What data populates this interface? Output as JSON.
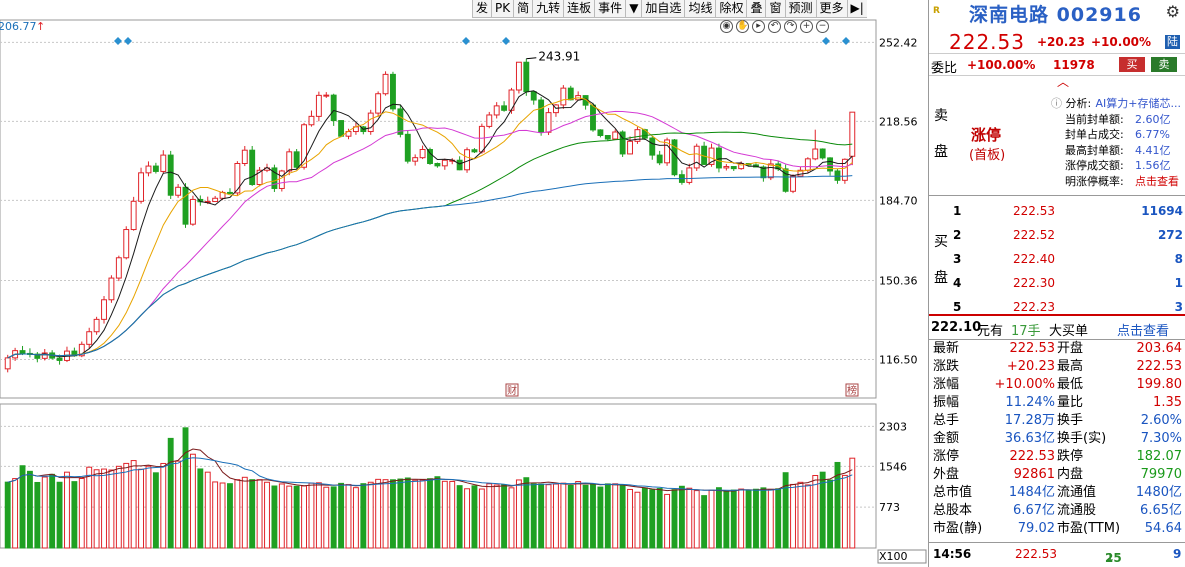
{
  "toolbar": {
    "items": [
      "发",
      "PK",
      "简",
      "九转",
      "连板",
      "事件",
      "▼",
      "加自选",
      "均线",
      "除权",
      "叠",
      "窗",
      "预测",
      "更多",
      "▶|"
    ],
    "left_value": "206.77"
  },
  "chart_top_icons": [
    "eye-icon",
    "hand-icon",
    "play-icon",
    "back-icon",
    "forward-icon",
    "zoom-in-icon",
    "zoom-out-icon"
  ],
  "colors": {
    "up": "#e0242a",
    "down": "#1fa022",
    "ma5": "#1a1a1a",
    "ma10": "#e8a400",
    "ma20": "#d43ad4",
    "ma60": "#0a8a0a",
    "ma120": "#1a6fb8",
    "grid": "#c8c8c8",
    "axis_text": "#000"
  },
  "price_axis": {
    "ticks": [
      "252.42",
      "218.56",
      "184.70",
      "150.36",
      "116.50"
    ],
    "max_label": "243.91"
  },
  "volume_axis": {
    "ticks": [
      "2303",
      "1546",
      "773"
    ],
    "unit": "X100"
  },
  "event_tags": {
    "cai": "财",
    "hu": "榜"
  },
  "candles": [
    [
      112.5,
      117.2,
      111.0,
      118.5
    ],
    [
      117.2,
      120.3,
      115.9,
      121.5
    ],
    [
      120.3,
      119.1,
      118.4,
      122.3
    ],
    [
      119.1,
      118.8,
      117.4,
      121.3
    ],
    [
      118.8,
      117.0,
      115.3,
      119.7
    ],
    [
      117.0,
      119.3,
      116.1,
      121.0
    ],
    [
      119.3,
      117.1,
      116.5,
      120.5
    ],
    [
      117.1,
      116.1,
      114.3,
      118.6
    ],
    [
      116.1,
      120.1,
      115.4,
      122.0
    ],
    [
      120.1,
      118.1,
      117.7,
      121.6
    ],
    [
      118.1,
      123.0,
      117.5,
      124.2
    ],
    [
      123.0,
      128.4,
      121.4,
      130.1
    ],
    [
      128.4,
      133.7,
      127.1,
      134.8
    ],
    [
      133.7,
      142.1,
      131.9,
      143.7
    ],
    [
      142.1,
      151.4,
      140.8,
      152.6
    ],
    [
      151.4,
      160.1,
      150.1,
      161.0
    ],
    [
      160.1,
      172.2,
      159.4,
      173.6
    ],
    [
      172.2,
      184.3,
      171.7,
      186.2
    ],
    [
      184.3,
      196.5,
      183.3,
      198.7
    ],
    [
      196.5,
      199.4,
      195.0,
      201.4
    ],
    [
      199.4,
      197.1,
      196.2,
      200.8
    ],
    [
      197.1,
      204.1,
      196.4,
      206.2
    ],
    [
      204.1,
      186.9,
      185.3,
      205.9
    ],
    [
      186.9,
      190.3,
      185.8,
      191.7
    ],
    [
      190.3,
      174.5,
      172.9,
      192.1
    ],
    [
      174.5,
      185.1,
      173.8,
      186.7
    ],
    [
      185.1,
      184.1,
      182.4,
      186.8
    ],
    [
      184.1,
      184.2,
      183.1,
      186.3
    ],
    [
      184.2,
      185.6,
      184.1,
      186.6
    ],
    [
      185.6,
      188.1,
      184.8,
      188.8
    ],
    [
      188.1,
      187.9,
      187.4,
      189.9
    ],
    [
      187.9,
      200.5,
      186.7,
      201.5
    ],
    [
      200.5,
      206.2,
      199.4,
      208.0
    ],
    [
      206.2,
      191.5,
      190.9,
      208.0
    ],
    [
      191.5,
      197.6,
      190.7,
      199.0
    ],
    [
      197.6,
      198.6,
      196.8,
      200.4
    ],
    [
      198.6,
      189.8,
      188.3,
      200.0
    ],
    [
      189.8,
      197.3,
      188.5,
      197.8
    ],
    [
      197.3,
      205.5,
      195.5,
      206.9
    ],
    [
      205.5,
      198.9,
      198.2,
      206.7
    ],
    [
      198.9,
      217.1,
      197.9,
      217.9
    ],
    [
      217.1,
      220.7,
      216.3,
      223.2
    ],
    [
      220.7,
      229.7,
      218.6,
      231.3
    ],
    [
      229.7,
      229.8,
      228.6,
      231.1
    ],
    [
      229.8,
      218.9,
      216.6,
      230.4
    ],
    [
      218.9,
      212.2,
      211.8,
      219.0
    ],
    [
      212.2,
      214.2,
      210.9,
      215.4
    ],
    [
      214.2,
      216.2,
      212.8,
      218.0
    ],
    [
      216.2,
      214.2,
      213.0,
      216.6
    ],
    [
      214.2,
      222.1,
      212.8,
      223.5
    ],
    [
      222.1,
      230.4,
      220.4,
      231.4
    ],
    [
      230.4,
      238.7,
      229.6,
      240.0
    ],
    [
      238.7,
      223.9,
      222.8,
      239.8
    ],
    [
      223.9,
      213.0,
      211.7,
      225.7
    ],
    [
      213.0,
      201.5,
      200.5,
      214.6
    ],
    [
      201.5,
      203.0,
      199.6,
      204.4
    ],
    [
      203.0,
      206.5,
      202.4,
      208.2
    ],
    [
      206.5,
      200.5,
      199.9,
      207.3
    ],
    [
      200.5,
      199.5,
      198.7,
      200.9
    ],
    [
      199.5,
      201.9,
      197.8,
      202.6
    ],
    [
      201.9,
      201.9,
      200.2,
      202.8
    ],
    [
      201.9,
      197.8,
      197.6,
      203.6
    ],
    [
      197.8,
      206.4,
      196.5,
      207.4
    ],
    [
      206.4,
      205.5,
      205.0,
      207.1
    ],
    [
      205.5,
      216.4,
      204.7,
      217.6
    ],
    [
      216.4,
      221.3,
      215.6,
      222.6
    ],
    [
      221.3,
      225.2,
      219.8,
      226.8
    ],
    [
      225.2,
      223.3,
      222.7,
      227.2
    ],
    [
      223.3,
      232.0,
      221.8,
      232.9
    ],
    [
      232.0,
      243.9,
      230.5,
      243.9
    ],
    [
      243.9,
      231.3,
      229.5,
      245.4
    ],
    [
      231.3,
      227.7,
      225.7,
      231.8
    ],
    [
      227.7,
      213.9,
      212.4,
      229.0
    ],
    [
      213.9,
      222.3,
      212.7,
      224.3
    ],
    [
      222.3,
      225.6,
      220.5,
      226.0
    ],
    [
      225.6,
      232.8,
      223.9,
      234.1
    ],
    [
      232.8,
      227.8,
      227.5,
      233.8
    ],
    [
      227.8,
      229.6,
      227.5,
      231.4
    ],
    [
      229.6,
      225.5,
      223.6,
      229.7
    ],
    [
      225.5,
      214.9,
      214.1,
      226.5
    ],
    [
      214.9,
      212.5,
      211.7,
      215.2
    ],
    [
      212.5,
      211.0,
      210.2,
      212.7
    ],
    [
      211.0,
      214.0,
      210.6,
      215.1
    ],
    [
      214.0,
      204.6,
      203.3,
      214.7
    ],
    [
      204.6,
      210.0,
      204.4,
      212.1
    ],
    [
      210.0,
      215.0,
      208.9,
      216.2
    ],
    [
      215.0,
      211.4,
      210.6,
      215.4
    ],
    [
      211.4,
      204.1,
      202.1,
      212.2
    ],
    [
      204.1,
      200.8,
      199.8,
      205.9
    ],
    [
      200.8,
      210.6,
      199.5,
      211.6
    ],
    [
      210.6,
      195.7,
      195.0,
      211.0
    ],
    [
      195.7,
      192.4,
      191.4,
      197.6
    ],
    [
      192.4,
      198.6,
      191.5,
      200.4
    ],
    [
      198.6,
      207.9,
      197.3,
      209.0
    ],
    [
      207.9,
      200.1,
      199.9,
      209.8
    ],
    [
      200.1,
      207.1,
      199.1,
      209.0
    ],
    [
      207.1,
      198.6,
      196.7,
      209.0
    ],
    [
      198.6,
      199.2,
      197.5,
      200.3
    ],
    [
      199.2,
      198.3,
      197.3,
      199.3
    ],
    [
      198.3,
      200.5,
      197.8,
      201.4
    ],
    [
      200.5,
      199.9,
      199.5,
      200.7
    ],
    [
      199.9,
      199.0,
      198.9,
      200.6
    ],
    [
      199.0,
      194.4,
      192.7,
      199.7
    ],
    [
      194.4,
      200.3,
      193.4,
      202.3
    ],
    [
      200.3,
      198.2,
      197.3,
      201.8
    ],
    [
      198.2,
      188.6,
      188.0,
      200.0
    ],
    [
      188.6,
      195.1,
      187.8,
      195.9
    ],
    [
      195.1,
      197.6,
      194.7,
      199.2
    ],
    [
      197.6,
      202.5,
      196.6,
      203.2
    ],
    [
      202.5,
      206.7,
      201.9,
      215.0
    ],
    [
      206.7,
      202.9,
      202.2,
      207.0
    ],
    [
      202.9,
      197.3,
      195.3,
      203.2
    ],
    [
      197.3,
      193.3,
      191.8,
      198.1
    ],
    [
      193.3,
      202.3,
      191.8,
      202.7
    ],
    [
      203.6,
      222.5,
      199.8,
      222.5
    ]
  ],
  "volumes": [
    [
      1247,
      "d"
    ],
    [
      1315,
      "u"
    ],
    [
      1558,
      "d"
    ],
    [
      1452,
      "d"
    ],
    [
      1241,
      "d"
    ],
    [
      1344,
      "u"
    ],
    [
      1395,
      "d"
    ],
    [
      1245,
      "d"
    ],
    [
      1436,
      "u"
    ],
    [
      1257,
      "d"
    ],
    [
      1316,
      "u"
    ],
    [
      1530,
      "u"
    ],
    [
      1482,
      "u"
    ],
    [
      1495,
      "u"
    ],
    [
      1477,
      "u"
    ],
    [
      1547,
      "u"
    ],
    [
      1602,
      "u"
    ],
    [
      1656,
      "u"
    ],
    [
      1492,
      "u"
    ],
    [
      1549,
      "u"
    ],
    [
      1424,
      "d"
    ],
    [
      1601,
      "u"
    ],
    [
      2076,
      "d"
    ],
    [
      1645,
      "u"
    ],
    [
      2276,
      "d"
    ],
    [
      1776,
      "u"
    ],
    [
      1497,
      "d"
    ],
    [
      1436,
      "u"
    ],
    [
      1251,
      "u"
    ],
    [
      1231,
      "u"
    ],
    [
      1218,
      "d"
    ],
    [
      1294,
      "u"
    ],
    [
      1339,
      "u"
    ],
    [
      1294,
      "d"
    ],
    [
      1294,
      "u"
    ],
    [
      1245,
      "u"
    ],
    [
      1174,
      "d"
    ],
    [
      1213,
      "u"
    ],
    [
      1172,
      "u"
    ],
    [
      1169,
      "d"
    ],
    [
      1175,
      "u"
    ],
    [
      1228,
      "u"
    ],
    [
      1235,
      "u"
    ],
    [
      1151,
      "u"
    ],
    [
      1157,
      "d"
    ],
    [
      1224,
      "d"
    ],
    [
      1203,
      "u"
    ],
    [
      1143,
      "u"
    ],
    [
      1218,
      "d"
    ],
    [
      1245,
      "u"
    ],
    [
      1300,
      "u"
    ],
    [
      1294,
      "u"
    ],
    [
      1292,
      "d"
    ],
    [
      1306,
      "d"
    ],
    [
      1326,
      "d"
    ],
    [
      1284,
      "u"
    ],
    [
      1288,
      "u"
    ],
    [
      1312,
      "d"
    ],
    [
      1350,
      "d"
    ],
    [
      1263,
      "u"
    ],
    [
      1260,
      "u"
    ],
    [
      1181,
      "d"
    ],
    [
      1122,
      "u"
    ],
    [
      1177,
      "d"
    ],
    [
      1117,
      "u"
    ],
    [
      1216,
      "u"
    ],
    [
      1193,
      "u"
    ],
    [
      1194,
      "d"
    ],
    [
      1140,
      "u"
    ],
    [
      1289,
      "u"
    ],
    [
      1331,
      "d"
    ],
    [
      1214,
      "d"
    ],
    [
      1209,
      "d"
    ],
    [
      1199,
      "u"
    ],
    [
      1211,
      "u"
    ],
    [
      1228,
      "u"
    ],
    [
      1184,
      "d"
    ],
    [
      1259,
      "u"
    ],
    [
      1187,
      "d"
    ],
    [
      1209,
      "d"
    ],
    [
      1154,
      "d"
    ],
    [
      1214,
      "d"
    ],
    [
      1216,
      "u"
    ],
    [
      1182,
      "d"
    ],
    [
      1109,
      "u"
    ],
    [
      1056,
      "u"
    ],
    [
      1138,
      "d"
    ],
    [
      1104,
      "d"
    ],
    [
      1126,
      "d"
    ],
    [
      1015,
      "u"
    ],
    [
      1105,
      "d"
    ],
    [
      1169,
      "d"
    ],
    [
      1132,
      "u"
    ],
    [
      1087,
      "u"
    ],
    [
      992,
      "d"
    ],
    [
      1094,
      "u"
    ],
    [
      1142,
      "d"
    ],
    [
      1069,
      "d"
    ],
    [
      1097,
      "d"
    ],
    [
      1116,
      "u"
    ],
    [
      1091,
      "d"
    ],
    [
      1113,
      "d"
    ],
    [
      1139,
      "d"
    ],
    [
      1110,
      "u"
    ],
    [
      1121,
      "d"
    ],
    [
      1426,
      "d"
    ],
    [
      1204,
      "u"
    ],
    [
      1244,
      "u"
    ],
    [
      1195,
      "u"
    ],
    [
      1373,
      "u"
    ],
    [
      1436,
      "d"
    ],
    [
      1285,
      "d"
    ],
    [
      1620,
      "d"
    ],
    [
      1375,
      "u"
    ],
    [
      1701,
      "u"
    ]
  ],
  "quote": {
    "name": "深南电路",
    "code": "002916",
    "price": "222.53",
    "change": "+20.23",
    "pct": "+10.00%",
    "lu": "陆"
  },
  "wei": {
    "label": "委比",
    "ratio": "+100.00%",
    "diff": "11978",
    "buy_btn": "买",
    "sell_btn": "卖"
  },
  "sell_label": "卖盘",
  "limit": {
    "title": "涨停",
    "sub": "(首板)"
  },
  "analysis": [
    {
      "k": "分析:",
      "v": "AI算力+存储芯..."
    },
    {
      "k": "当前封单额:",
      "v": "2.60亿"
    },
    {
      "k": "封单占成交:",
      "v": "6.77%"
    },
    {
      "k": "最高封单额:",
      "v": "4.41亿"
    },
    {
      "k": "涨停成交额:",
      "v": "1.56亿"
    },
    {
      "k": "明涨停概率:",
      "v": "点击查看"
    }
  ],
  "buy_label": "买盘",
  "book": [
    {
      "i": "1",
      "p": "222.53",
      "v": "11694"
    },
    {
      "i": "2",
      "p": "222.52",
      "v": "272"
    },
    {
      "i": "3",
      "p": "222.40",
      "v": "8"
    },
    {
      "i": "4",
      "p": "222.30",
      "v": "1"
    },
    {
      "i": "5",
      "p": "222.23",
      "v": "3"
    }
  ],
  "bigorder": {
    "price": "222.10",
    "unit": "元有",
    "hands": "17手",
    "type": "大买单",
    "link": "点击查看"
  },
  "stats": [
    [
      {
        "k": "最新",
        "v": "222.53",
        "c": "r"
      },
      {
        "k": "开盘",
        "v": "203.64",
        "c": "r"
      }
    ],
    [
      {
        "k": "涨跌",
        "v": "+20.23",
        "c": "r"
      },
      {
        "k": "最高",
        "v": "222.53",
        "c": "r"
      }
    ],
    [
      {
        "k": "涨幅",
        "v": "+10.00%",
        "c": "r"
      },
      {
        "k": "最低",
        "v": "199.80",
        "c": "r"
      }
    ],
    [
      {
        "k": "振幅",
        "v": "11.24%",
        "c": "b"
      },
      {
        "k": "量比",
        "v": "1.35",
        "c": "r"
      }
    ],
    [
      {
        "k": "总手",
        "v": "17.28万",
        "c": "b"
      },
      {
        "k": "换手",
        "v": "2.60%",
        "c": "b"
      }
    ],
    [
      {
        "k": "金额",
        "v": "36.63亿",
        "c": "b"
      },
      {
        "k": "换手(实)",
        "v": "7.30%",
        "c": "b"
      }
    ],
    [
      {
        "k": "涨停",
        "v": "222.53",
        "c": "r"
      },
      {
        "k": "跌停",
        "v": "182.07",
        "c": "g"
      }
    ],
    [
      {
        "k": "外盘",
        "v": "92861",
        "c": "r"
      },
      {
        "k": "内盘",
        "v": "79970",
        "c": "g"
      }
    ],
    [
      {
        "k": "总市值",
        "v": "1484亿",
        "c": "b"
      },
      {
        "k": "流通值",
        "v": "1480亿",
        "c": "b"
      }
    ],
    [
      {
        "k": "总股本",
        "v": "6.67亿",
        "c": "b"
      },
      {
        "k": "流通股",
        "v": "6.65亿",
        "c": "b"
      }
    ],
    [
      {
        "k": "市盈(静)",
        "v": "79.02",
        "c": "b"
      },
      {
        "k": "市盈(TTM)",
        "v": "54.64",
        "c": "b"
      }
    ]
  ],
  "tick": {
    "time": "14:56",
    "price": "222.53",
    "vol": "25",
    "arrow": "↓",
    "num": "9"
  }
}
